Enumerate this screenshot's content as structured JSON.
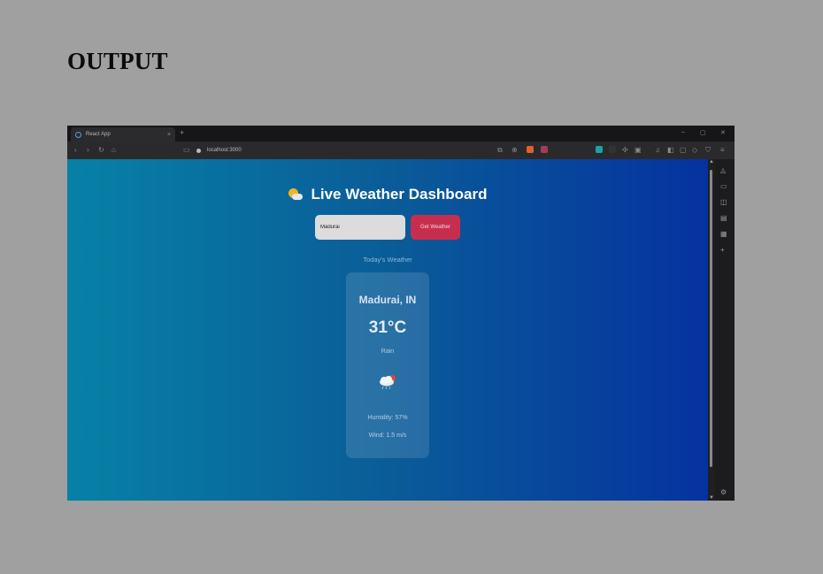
{
  "heading": "OUTPUT",
  "browser": {
    "tab_title": "React App",
    "tab_close": "×",
    "new_tab": "+",
    "url": "localhost:3000",
    "window_controls": {
      "minimize": "–",
      "maximize": "▢",
      "close": "✕"
    }
  },
  "toolbar_icons": {
    "back": "‹",
    "forward": "›",
    "reload": "↻",
    "home": "⌂",
    "bookmark": "▭"
  },
  "app": {
    "title": "Live Weather Dashboard",
    "search": {
      "value": "Madurai"
    },
    "get_button": "Get Weather",
    "today_label": "Today's Weather",
    "card": {
      "city": "Madurai, IN",
      "temperature": "31°C",
      "condition": "Rain",
      "humidity": "Humidity: 57%",
      "wind": "Wind: 1.5 m/s"
    }
  },
  "colors": {
    "gradient_start": "#0781a6",
    "gradient_end": "#0532a0",
    "button": "#c72e4e"
  }
}
